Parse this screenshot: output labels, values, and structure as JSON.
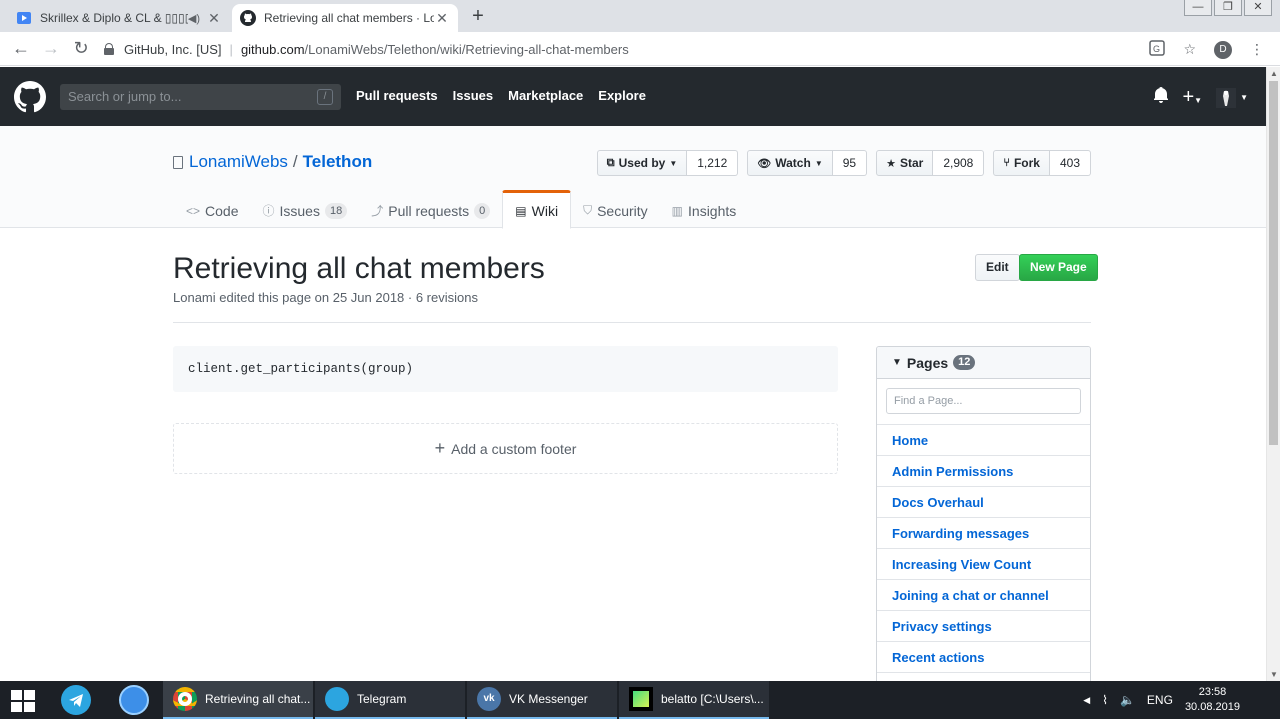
{
  "browser": {
    "tabs": [
      {
        "title": "Skrillex & Diplo & CL & ▯▯▯▯"
      },
      {
        "title": "Retrieving all chat members · Lon"
      }
    ],
    "origin": "GitHub, Inc. [US]",
    "url_host": "github.com",
    "url_path": "/LonamiWebs/Telethon/wiki/Retrieving-all-chat-members",
    "profile_initial": "D"
  },
  "header": {
    "search_placeholder": "Search or jump to...",
    "slash_hint": "/",
    "nav": [
      "Pull requests",
      "Issues",
      "Marketplace",
      "Explore"
    ]
  },
  "repo": {
    "owner": "LonamiWebs",
    "separator": "/",
    "name": "Telethon",
    "actions": {
      "used_by_label": "Used by",
      "used_by_count": "1,212",
      "watch_label": "Watch",
      "watch_count": "95",
      "star_label": "Star",
      "star_count": "2,908",
      "fork_label": "Fork",
      "fork_count": "403"
    },
    "tabs": {
      "code": "Code",
      "issues": "Issues",
      "issues_count": "18",
      "pulls": "Pull requests",
      "pulls_count": "0",
      "wiki": "Wiki",
      "security": "Security",
      "insights": "Insights"
    }
  },
  "wiki": {
    "title": "Retrieving all chat members",
    "meta": "Lonami edited this page on 25 Jun 2018 · 6 revisions",
    "edit_label": "Edit",
    "new_page_label": "New Page",
    "code": "client.get_participants(group)",
    "add_footer": "Add a custom footer"
  },
  "sidebar": {
    "title": "Pages",
    "count": "12",
    "filter_placeholder": "Find a Page...",
    "pages": [
      "Home",
      "Admin Permissions",
      "Docs Overhaul",
      "Forwarding messages",
      "Increasing View Count",
      "Joining a chat or channel",
      "Privacy settings",
      "Recent actions"
    ]
  },
  "taskbar": {
    "tasks": [
      {
        "label": "Retrieving all chat..."
      },
      {
        "label": "Telegram"
      },
      {
        "label": "VK Messenger"
      },
      {
        "label": "belatto [C:\\Users\\..."
      }
    ],
    "lang": "ENG",
    "time": "23:58",
    "date": "30.08.2019"
  },
  "colors": {
    "gh_header": "#24292e",
    "link": "#0366d6",
    "new_page_green": "#28a745",
    "wiki_tab_accent": "#e36209"
  }
}
